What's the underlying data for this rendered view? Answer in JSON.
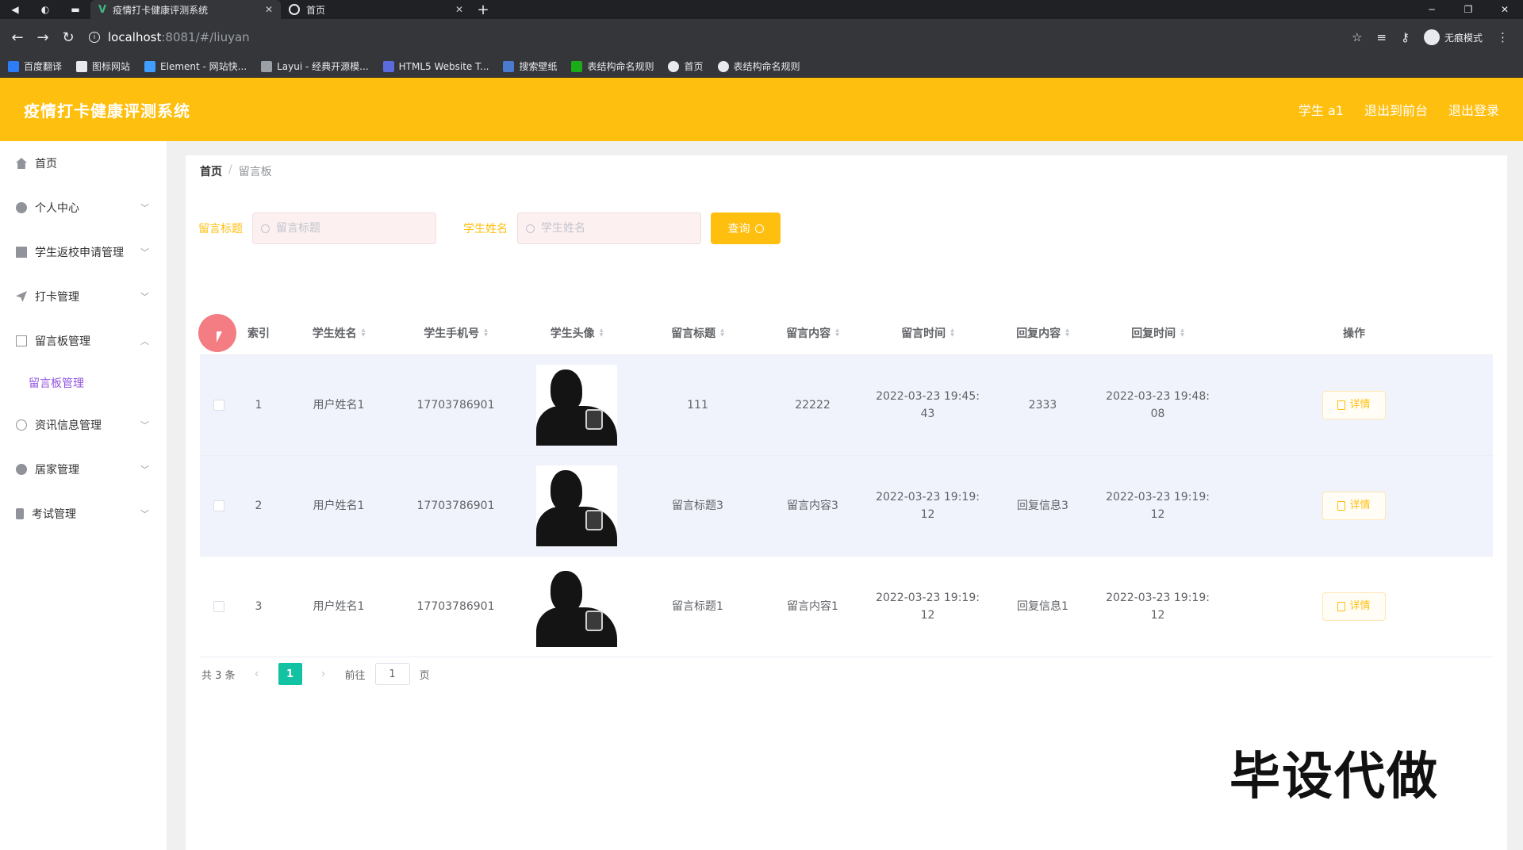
{
  "browser": {
    "tabs": [
      {
        "title": "疫情打卡健康评测系统"
      },
      {
        "title": "首页"
      }
    ],
    "url_host": "localhost",
    "url_path": ":8081/#/liuyan",
    "incognito_label": "无痕模式",
    "bookmarks": [
      {
        "label": "百度翻译",
        "color": "#2b7cf6"
      },
      {
        "label": "图标网站",
        "color": "#e8eaed"
      },
      {
        "label": "Element - 网站快...",
        "color": "#409eff"
      },
      {
        "label": "Layui - 经典开源模...",
        "color": "#9aa0a6"
      },
      {
        "label": "HTML5 Website T...",
        "color": "#5b6bde"
      },
      {
        "label": "搜索壁纸",
        "color": "#4a7bd0"
      },
      {
        "label": "表结构命名规则",
        "color": "#1aad19"
      },
      {
        "label": "首页",
        "color": "#e8eaed"
      },
      {
        "label": "表结构命名规则",
        "color": "#e8eaed"
      }
    ]
  },
  "header": {
    "title": "疫情打卡健康评测系统",
    "user": "学生 a1",
    "back_front": "退出到前台",
    "logout": "退出登录",
    "color": "#ffbf0e"
  },
  "sidebar": {
    "items": [
      {
        "label": "首页",
        "icon": "home-icon"
      },
      {
        "label": "个人中心",
        "icon": "user-icon"
      },
      {
        "label": "学生返校申请管理",
        "icon": "clipboard-icon"
      },
      {
        "label": "打卡管理",
        "icon": "send-icon"
      },
      {
        "label": "留言板管理",
        "icon": "message-icon"
      },
      {
        "label": "资讯信息管理",
        "icon": "compass-icon"
      },
      {
        "label": "居家管理",
        "icon": "user-icon"
      },
      {
        "label": "考试管理",
        "icon": "phone-icon"
      }
    ],
    "submenu": {
      "label": "留言板管理"
    }
  },
  "breadcrumb": {
    "home": "首页",
    "current": "留言板"
  },
  "search": {
    "title_label": "留言标题",
    "title_placeholder": "留言标题",
    "name_label": "学生姓名",
    "name_placeholder": "学生姓名",
    "query_button": "查询"
  },
  "table": {
    "headers": {
      "index": "索引",
      "name": "学生姓名",
      "phone": "学生手机号",
      "avatar": "学生头像",
      "title": "留言标题",
      "content": "留言内容",
      "time": "留言时间",
      "reply": "回复内容",
      "reply_time": "回复时间",
      "op": "操作"
    },
    "rows": [
      {
        "index": "1",
        "name": "用户姓名1",
        "phone": "17703786901",
        "title": "111",
        "content": "22222",
        "time_a": "2022-03-23 19:45:",
        "time_b": "43",
        "reply": "2333",
        "rtime_a": "2022-03-23 19:48:",
        "rtime_b": "08",
        "detail": "详情"
      },
      {
        "index": "2",
        "name": "用户姓名1",
        "phone": "17703786901",
        "title": "留言标题3",
        "content": "留言内容3",
        "time_a": "2022-03-23 19:19:",
        "time_b": "12",
        "reply": "回复信息3",
        "rtime_a": "2022-03-23 19:19:",
        "rtime_b": "12",
        "detail": "详情"
      },
      {
        "index": "3",
        "name": "用户姓名1",
        "phone": "17703786901",
        "title": "留言标题1",
        "content": "留言内容1",
        "time_a": "2022-03-23 19:19:",
        "time_b": "12",
        "reply": "回复信息1",
        "rtime_a": "2022-03-23 19:19:",
        "rtime_b": "12",
        "detail": "详情"
      }
    ]
  },
  "pager": {
    "total": "共 3 条",
    "current": "1",
    "goto": "前往",
    "goto_value": "1",
    "page_suffix": "页"
  },
  "watermark": "毕设代做"
}
